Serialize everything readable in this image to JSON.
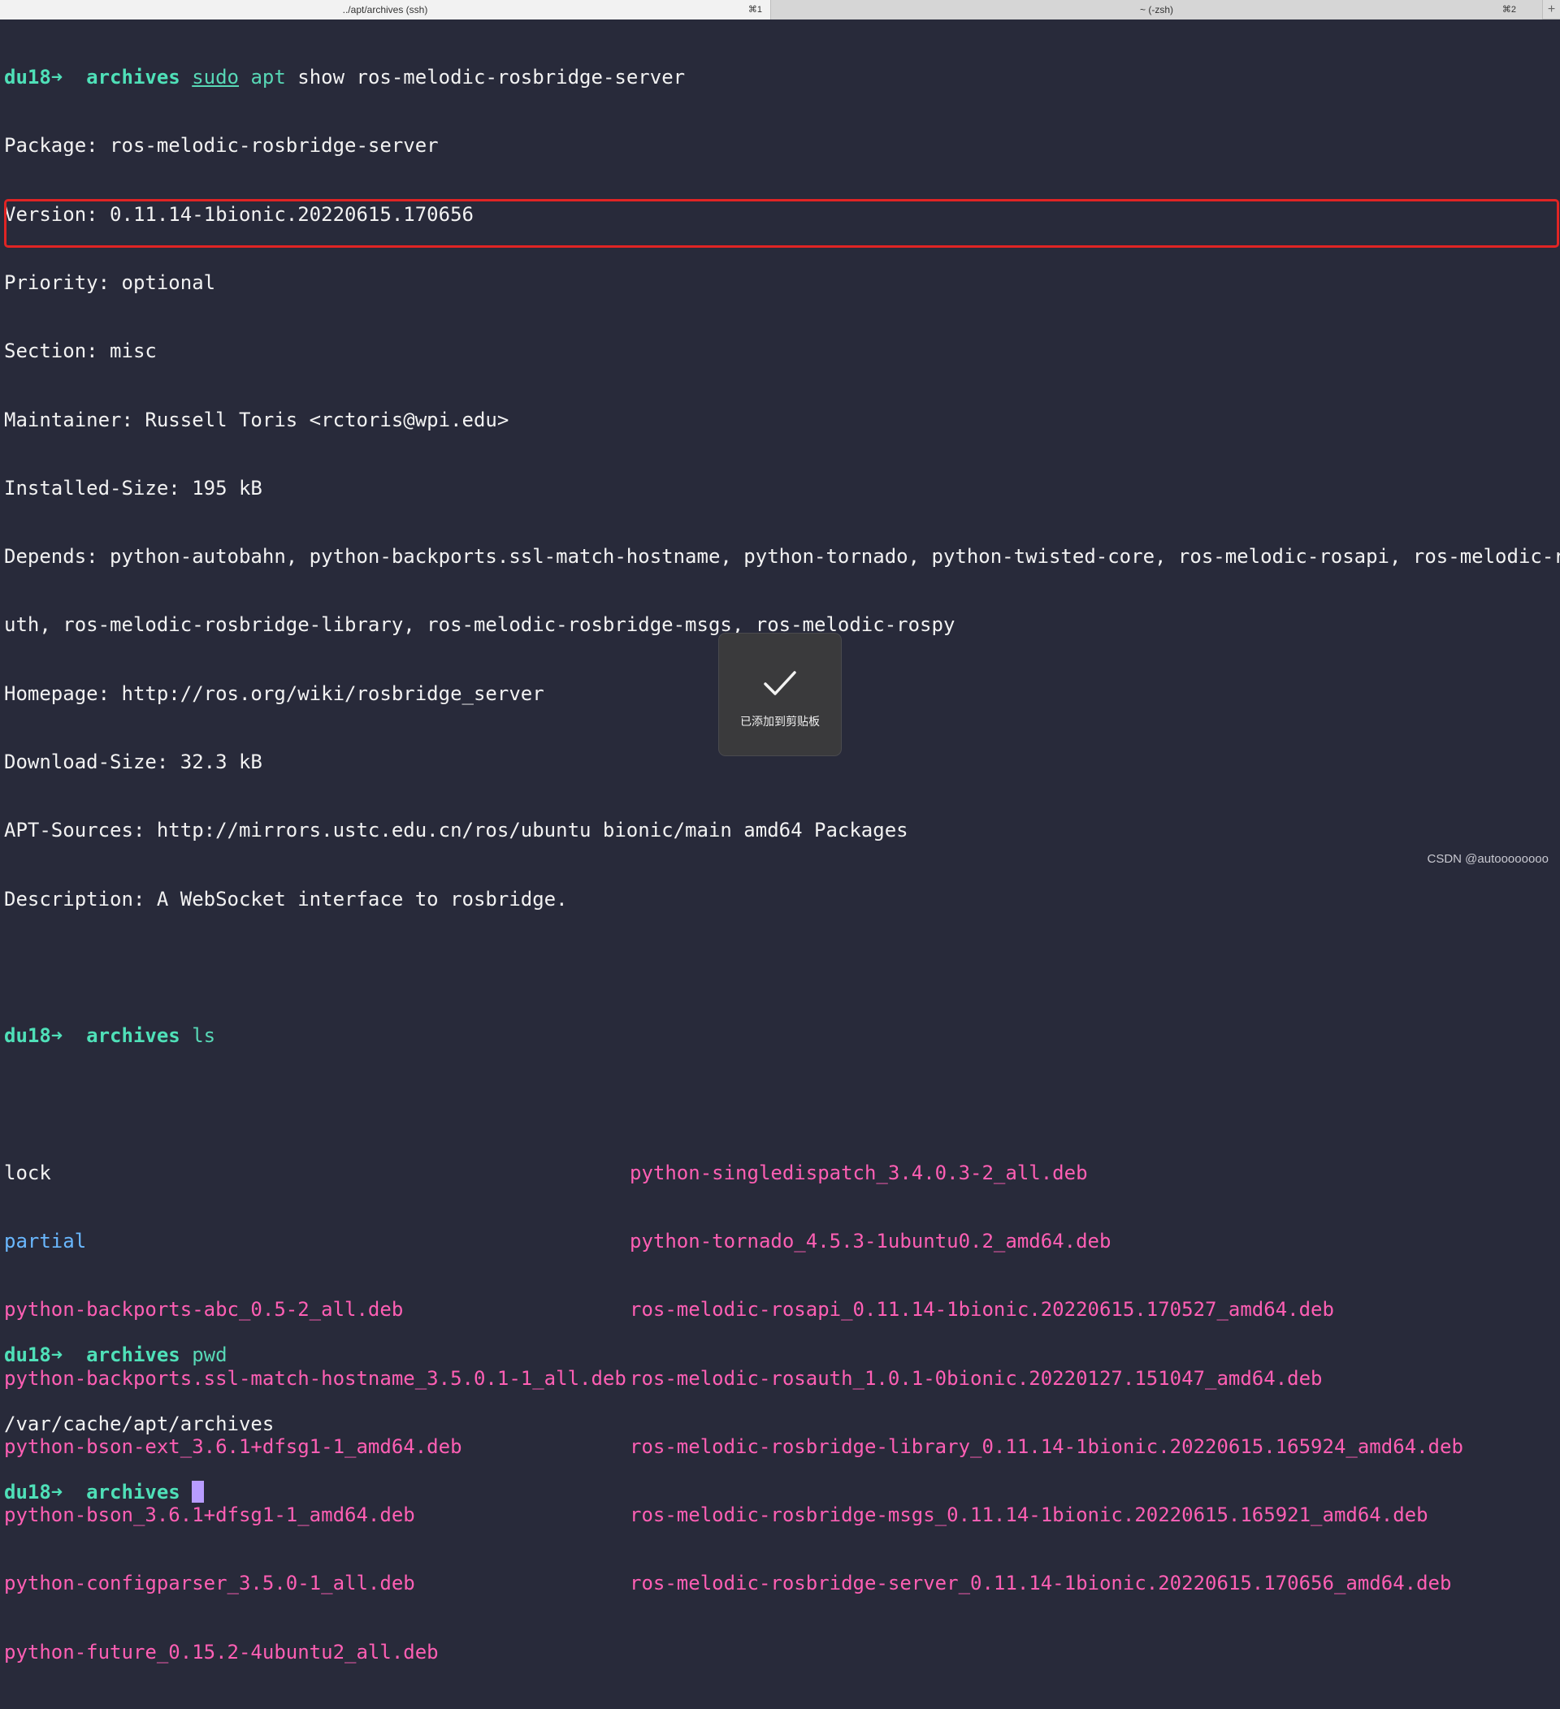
{
  "tabs": [
    {
      "title": "../apt/archives (ssh)",
      "shortcut": "⌘1"
    },
    {
      "title": "~ (-zsh)",
      "shortcut": "⌘2"
    }
  ],
  "tab_add_label": "+",
  "prompt": {
    "host": "du18➜",
    "dir": "archives"
  },
  "commands": {
    "show": {
      "sudo": "sudo",
      "apt": "apt",
      "args": " show ros-melodic-rosbridge-server"
    },
    "ls": "ls",
    "pwd": "pwd"
  },
  "show_output": {
    "package": "Package: ros-melodic-rosbridge-server",
    "version": "Version: 0.11.14-1bionic.20220615.170656",
    "priority": "Priority: optional",
    "section": "Section: misc",
    "maintainer": "Maintainer: Russell Toris <rctoris@wpi.edu>",
    "installed_size": "Installed-Size: 195 kB",
    "depends_line1": "Depends: python-autobahn, python-backports.ssl-match-hostname, python-tornado, python-twisted-core, ros-melodic-rosapi, ros-melodic-rosa",
    "depends_line2": "uth, ros-melodic-rosbridge-library, ros-melodic-rosbridge-msgs, ros-melodic-rospy",
    "homepage": "Homepage: http://ros.org/wiki/rosbridge_server",
    "download_size": "Download-Size: 32.3 kB",
    "apt_sources": "APT-Sources: http://mirrors.ustc.edu.cn/ros/ubuntu bionic/main amd64 Packages",
    "description": "Description: A WebSocket interface to rosbridge."
  },
  "ls_output": {
    "col1": [
      {
        "name": "lock",
        "kind": "file"
      },
      {
        "name": "partial",
        "kind": "dir"
      },
      {
        "name": "python-backports-abc_0.5-2_all.deb",
        "kind": "deb"
      },
      {
        "name": "python-backports.ssl-match-hostname_3.5.0.1-1_all.deb",
        "kind": "deb"
      },
      {
        "name": "python-bson-ext_3.6.1+dfsg1-1_amd64.deb",
        "kind": "deb"
      },
      {
        "name": "python-bson_3.6.1+dfsg1-1_amd64.deb",
        "kind": "deb"
      },
      {
        "name": "python-configparser_3.5.0-1_all.deb",
        "kind": "deb"
      },
      {
        "name": "python-future_0.15.2-4ubuntu2_all.deb",
        "kind": "deb"
      }
    ],
    "col2": [
      {
        "name": "python-singledispatch_3.4.0.3-2_all.deb",
        "kind": "deb"
      },
      {
        "name": "python-tornado_4.5.3-1ubuntu0.2_amd64.deb",
        "kind": "deb"
      },
      {
        "name": "ros-melodic-rosapi_0.11.14-1bionic.20220615.170527_amd64.deb",
        "kind": "deb"
      },
      {
        "name": "ros-melodic-rosauth_1.0.1-0bionic.20220127.151047_amd64.deb",
        "kind": "deb"
      },
      {
        "name": "ros-melodic-rosbridge-library_0.11.14-1bionic.20220615.165924_amd64.deb",
        "kind": "deb"
      },
      {
        "name": "ros-melodic-rosbridge-msgs_0.11.14-1bionic.20220615.165921_amd64.deb",
        "kind": "deb"
      },
      {
        "name": "ros-melodic-rosbridge-server_0.11.14-1bionic.20220615.170656_amd64.deb",
        "kind": "deb"
      }
    ]
  },
  "pwd_output": "/var/cache/apt/archives",
  "toast": {
    "icon": "checkmark-icon",
    "text": "已添加到剪贴板"
  },
  "watermark": "CSDN @autoooooooo",
  "colors": {
    "background": "#282a3a",
    "prompt": "#4fe0b8",
    "command": "#58d8b6",
    "directory": "#6ab8ff",
    "deb_file": "#ff5fb4",
    "highlight": "#e02424",
    "cursor": "#b89cff"
  }
}
